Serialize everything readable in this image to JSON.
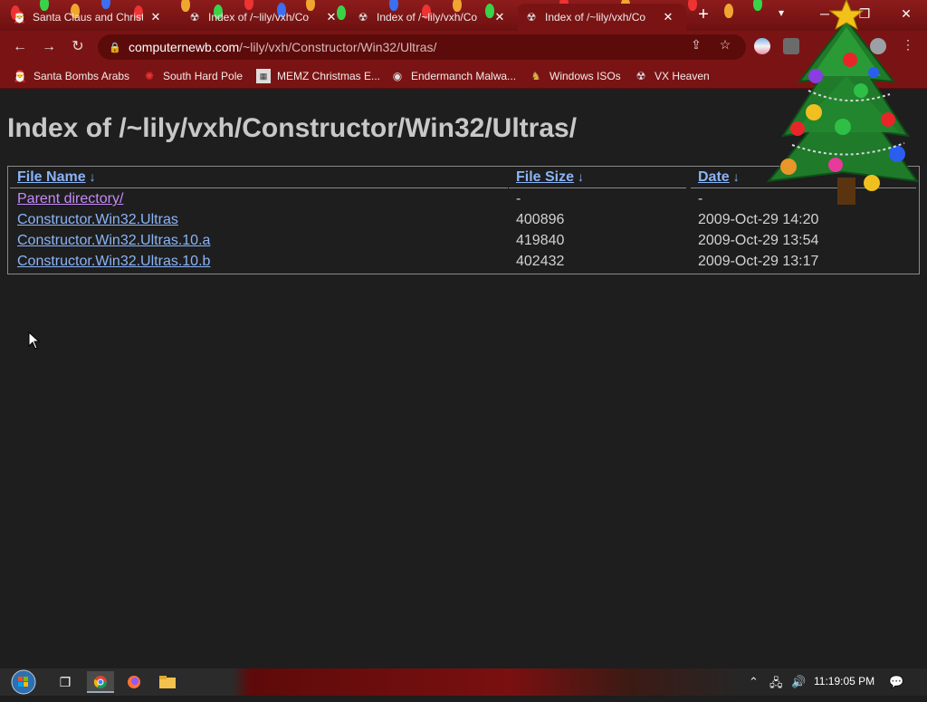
{
  "browser": {
    "tabs": [
      {
        "title": "Santa Claus and Christ",
        "icon": "santa-favicon",
        "active": false
      },
      {
        "title": "Index of /~lily/vxh/Co",
        "icon": "vx-heaven-favicon",
        "active": false
      },
      {
        "title": "Index of /~lily/vxh/Co",
        "icon": "vx-heaven-favicon",
        "active": false
      },
      {
        "title": "Index of /~lily/vxh/Co",
        "icon": "vx-heaven-favicon",
        "active": true
      }
    ],
    "close_glyph": "✕",
    "new_tab_glyph": "+",
    "url_host": "computernewb.com",
    "url_path": "/~lily/vxh/Constructor/Win32/Ultras/",
    "bookmarks": [
      {
        "label": "Santa Bombs Arabs",
        "icon": "santa-icon"
      },
      {
        "label": "South Hard Pole",
        "icon": "snowflake-icon"
      },
      {
        "label": "MEMZ Christmas E...",
        "icon": "memz-icon"
      },
      {
        "label": "Endermanch Malwa...",
        "icon": "endermanch-icon"
      },
      {
        "label": "Windows ISOs",
        "icon": "windows-iso-icon"
      },
      {
        "label": "VX Heaven",
        "icon": "vx-heaven-icon"
      }
    ]
  },
  "page": {
    "heading": "Index of /~lily/vxh/Constructor/Win32/Ultras/",
    "columns": {
      "name": "File Name",
      "size": "File Size",
      "date": "Date",
      "sort_arrow": "↓"
    },
    "rows": [
      {
        "name": "Parent directory/",
        "size": "-",
        "date": "-",
        "visited": true
      },
      {
        "name": "Constructor.Win32.Ultras",
        "size": "400896",
        "date": "2009-Oct-29 14:20",
        "visited": false
      },
      {
        "name": "Constructor.Win32.Ultras.10.a",
        "size": "419840",
        "date": "2009-Oct-29 13:54",
        "visited": false
      },
      {
        "name": "Constructor.Win32.Ultras.10.b",
        "size": "402432",
        "date": "2009-Oct-29 13:17",
        "visited": false
      }
    ]
  },
  "taskbar": {
    "clock": "11:19:05 PM",
    "pinned": [
      "start-orb-icon",
      "task-view-icon",
      "chrome-icon",
      "firefox-icon",
      "file-explorer-icon"
    ]
  },
  "colors": {
    "chrome_frame": "#7a1414",
    "link": "#8ab4f8",
    "visited_link": "#c58af9",
    "page_bg": "#1e1e1e"
  }
}
